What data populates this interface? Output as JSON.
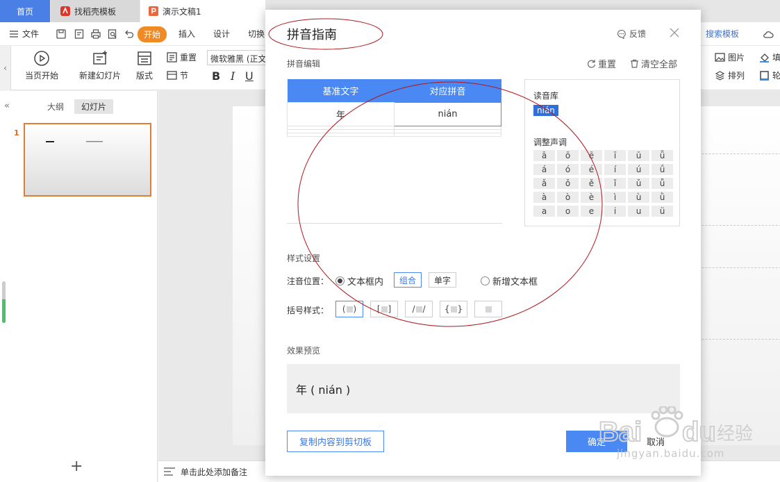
{
  "tabs": {
    "home": "首页",
    "template": "找稻壳模板",
    "doc": "演示文稿1"
  },
  "menu": {
    "file": "文件",
    "start": "开始",
    "insert": "插入",
    "design": "设计",
    "switch": "切换",
    "search_template": "搜索模板"
  },
  "ribbon": {
    "current_start": "当页开始",
    "new_slide": "新建幻灯片",
    "layout": "版式",
    "reset": "重置",
    "section": "节",
    "font": "微软雅黑 (正文",
    "bold": "B",
    "italic": "I",
    "underline": "U",
    "picture": "图片",
    "arrange": "排列",
    "fill": "填",
    "outline": "轮"
  },
  "left_panel": {
    "tab_outline": "大纲",
    "tab_slides": "幻灯片",
    "slide_number": "1",
    "add": "+"
  },
  "notes": {
    "placeholder": "单击此处添加备注"
  },
  "dialog": {
    "title": "拼音指南",
    "feedback": "反馈",
    "edit_label": "拼音编辑",
    "reset": "重置",
    "clear_all": "清空全部",
    "table": {
      "headers": [
        "基准文字",
        "对应拼音"
      ],
      "rows": [
        [
          "年",
          "nián"
        ]
      ]
    },
    "library": {
      "title": "读音库",
      "chip": "nián",
      "tone_title": "调整声调",
      "tones": [
        [
          "ā",
          "ō",
          "ē",
          "ī",
          "ū",
          "ǖ"
        ],
        [
          "á",
          "ó",
          "é",
          "í",
          "ú",
          "ǘ"
        ],
        [
          "ǎ",
          "ǒ",
          "ě",
          "ǐ",
          "ǔ",
          "ǚ"
        ],
        [
          "à",
          "ò",
          "è",
          "ì",
          "ù",
          "ǜ"
        ],
        [
          "a",
          "o",
          "e",
          "i",
          "u",
          "ü"
        ]
      ]
    },
    "style_label": "样式设置",
    "position_label": "注音位置：",
    "pos_inbox": "文本框内",
    "pos_group": "组合",
    "pos_single": "单字",
    "pos_newbox": "新增文本框",
    "bracket_label": "括号样式：",
    "brackets": [
      {
        "l": "(",
        "r": ")"
      },
      {
        "l": "[",
        "r": "]"
      },
      {
        "l": "/",
        "r": "/"
      },
      {
        "l": "{",
        "r": "}"
      },
      {
        "l": "",
        "r": ""
      }
    ],
    "preview_label": "效果预览",
    "preview_text": "年 ( nián )",
    "copy": "复制内容到剪切板",
    "ok": "确定",
    "cancel": "取消"
  },
  "watermark": {
    "url": "jingyan.baidu.com"
  },
  "colors": {
    "accent": "#4a89f3",
    "start_tab": "#f08a24",
    "annotation": "#b0161b"
  }
}
